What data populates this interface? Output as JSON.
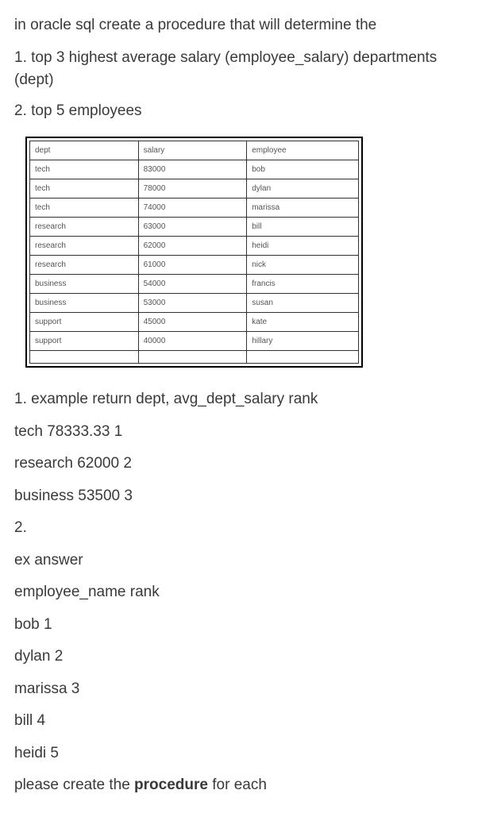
{
  "intro_line1": "in oracle sql create a procedure that will determine the",
  "q1": "1. top 3 highest average salary (employee_salary) departments (dept)",
  "q2": "2. top 5 employees",
  "table": {
    "headers": {
      "dept": "dept",
      "salary": "salary",
      "employee": "employee"
    },
    "rows": [
      {
        "dept": "tech",
        "salary": "83000",
        "employee": "bob"
      },
      {
        "dept": "tech",
        "salary": "78000",
        "employee": "dylan"
      },
      {
        "dept": "tech",
        "salary": "74000",
        "employee": "marissa"
      },
      {
        "dept": "research",
        "salary": "63000",
        "employee": "bill"
      },
      {
        "dept": "research",
        "salary": "62000",
        "employee": "heidi"
      },
      {
        "dept": "research",
        "salary": "61000",
        "employee": "nick"
      },
      {
        "dept": "business",
        "salary": "54000",
        "employee": "francis"
      },
      {
        "dept": "business",
        "salary": "53000",
        "employee": "susan"
      },
      {
        "dept": "support",
        "salary": "45000",
        "employee": "kate"
      },
      {
        "dept": "support",
        "salary": "40000",
        "employee": "hillary"
      }
    ]
  },
  "ex1_header": "1. example return dept, avg_dept_salary rank",
  "ex1_lines": [
    "tech 78333.33 1",
    "research 62000 2",
    "business 53500 3"
  ],
  "ex2_num": "2.",
  "ex2_header": "ex answer",
  "ex2_colhead": "employee_name rank",
  "ex2_lines": [
    "bob 1",
    "dylan 2",
    "marissa 3",
    "bill 4",
    "heidi 5"
  ],
  "closing_pre": "please create the ",
  "closing_bold": "procedure",
  "closing_post": " for each",
  "chart_data": {
    "type": "table",
    "columns": [
      "dept",
      "salary",
      "employee"
    ],
    "rows": [
      [
        "tech",
        83000,
        "bob"
      ],
      [
        "tech",
        78000,
        "dylan"
      ],
      [
        "tech",
        74000,
        "marissa"
      ],
      [
        "research",
        63000,
        "bill"
      ],
      [
        "research",
        62000,
        "heidi"
      ],
      [
        "research",
        61000,
        "nick"
      ],
      [
        "business",
        54000,
        "francis"
      ],
      [
        "business",
        53000,
        "susan"
      ],
      [
        "support",
        45000,
        "kate"
      ],
      [
        "support",
        40000,
        "hillary"
      ]
    ]
  }
}
